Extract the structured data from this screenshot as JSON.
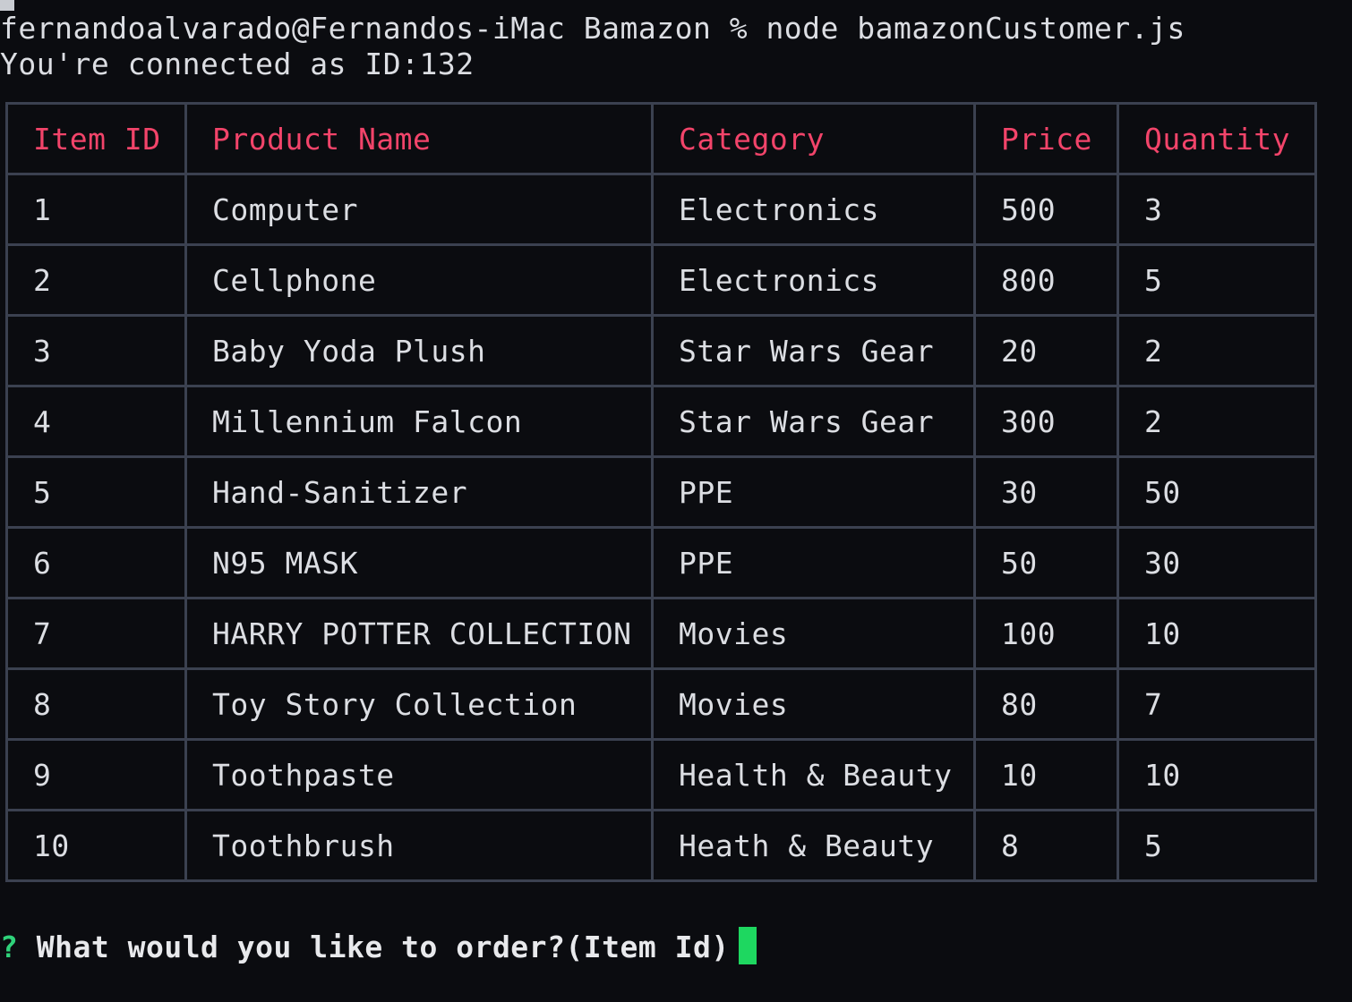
{
  "terminal": {
    "command_line": "fernandoalvarado@Fernandos-iMac Bamazon % node bamazonCustomer.js",
    "connection_line": "You're connected as ID:132",
    "colors": {
      "background": "#0b0c10",
      "text": "#dcdee3",
      "header_text": "#f2446a",
      "table_border": "#3b4150",
      "prompt_mark": "#2fd27a",
      "cursor": "#1ed760"
    }
  },
  "table": {
    "columns": [
      "Item ID",
      "Product Name",
      "Category",
      "Price",
      "Quantity"
    ],
    "rows": [
      [
        "1",
        "Computer",
        "Electronics",
        "500",
        "3"
      ],
      [
        "2",
        "Cellphone",
        "Electronics",
        "800",
        "5"
      ],
      [
        "3",
        "Baby Yoda Plush",
        "Star Wars Gear",
        "20",
        "2"
      ],
      [
        "4",
        "Millennium Falcon",
        "Star Wars Gear",
        "300",
        "2"
      ],
      [
        "5",
        "Hand-Sanitizer",
        "PPE",
        "30",
        "50"
      ],
      [
        "6",
        "N95 MASK",
        "PPE",
        "50",
        "30"
      ],
      [
        "7",
        "HARRY POTTER COLLECTION",
        "Movies",
        "100",
        "10"
      ],
      [
        "8",
        "Toy Story Collection",
        "Movies",
        "80",
        "7"
      ],
      [
        "9",
        "Toothpaste",
        "Health & Beauty",
        "10",
        "10"
      ],
      [
        "10",
        "Toothbrush",
        "Heath & Beauty",
        "8",
        "5"
      ]
    ]
  },
  "prompt": {
    "mark": "?",
    "question": "What would you like to order?(Item Id)",
    "input_value": ""
  }
}
